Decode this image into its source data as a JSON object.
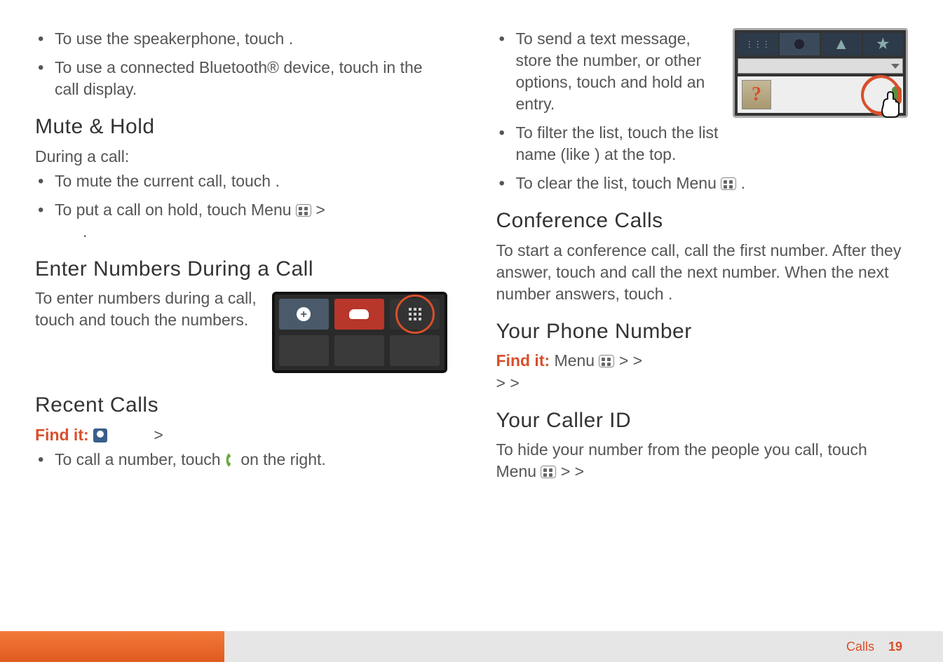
{
  "left": {
    "bullet1": "To use the speakerphone, touch           .",
    "bullet2": "To use a connected Bluetooth® device, touch                 in the call display.",
    "h_mute": "Mute & Hold",
    "mute_intro": "During a call:",
    "mute_b1": "To mute the current call, touch             .",
    "mute_b2_pre": "To put a call on hold, touch Menu ",
    "mute_b2_post": " >",
    "mute_b2_line2": ".",
    "h_enter": "Enter Numbers During a Call",
    "enter_p": "To enter numbers during a call, touch            and touch the numbers.",
    "h_recent": "Recent Calls",
    "recent_findit": "Find it: ",
    "recent_findit_gt": " >",
    "recent_b1_pre": "To call a number, touch ",
    "recent_b1_post": " on the right."
  },
  "right": {
    "b1": "To send a text message, store the number, or other options, touch and hold an entry.",
    "b2": "To filter the list, touch the list name (like              ) at the top.",
    "b3_pre": "To clear the list, touch Menu ",
    "b3_post": ".",
    "h_conf": "Conference Calls",
    "conf_p": "To start a conference call, call the first number. After they answer, touch          and call the next number. When the next number answers, touch             .",
    "h_your_num": "Your Phone Number",
    "yn_findit": "Find it: ",
    "yn_menu": "Menu ",
    "yn_gt1": " >                 >",
    "yn_gt2": "         >             >",
    "h_caller": "Your Caller ID",
    "caller_p_pre": "To hide your number from the people you call, touch Menu ",
    "caller_p_post": " >                 >"
  },
  "footer": {
    "section": "Calls",
    "page": "19"
  },
  "dialpad": {
    "buttons": [
      "add-call",
      "end-call",
      "dialpad-grid",
      "blank",
      "blank",
      "blank"
    ]
  },
  "recent_shot": {
    "tabs": [
      "grid-icon",
      "clock-icon",
      "person-icon",
      "star-icon"
    ],
    "avatar_symbol": "?"
  }
}
